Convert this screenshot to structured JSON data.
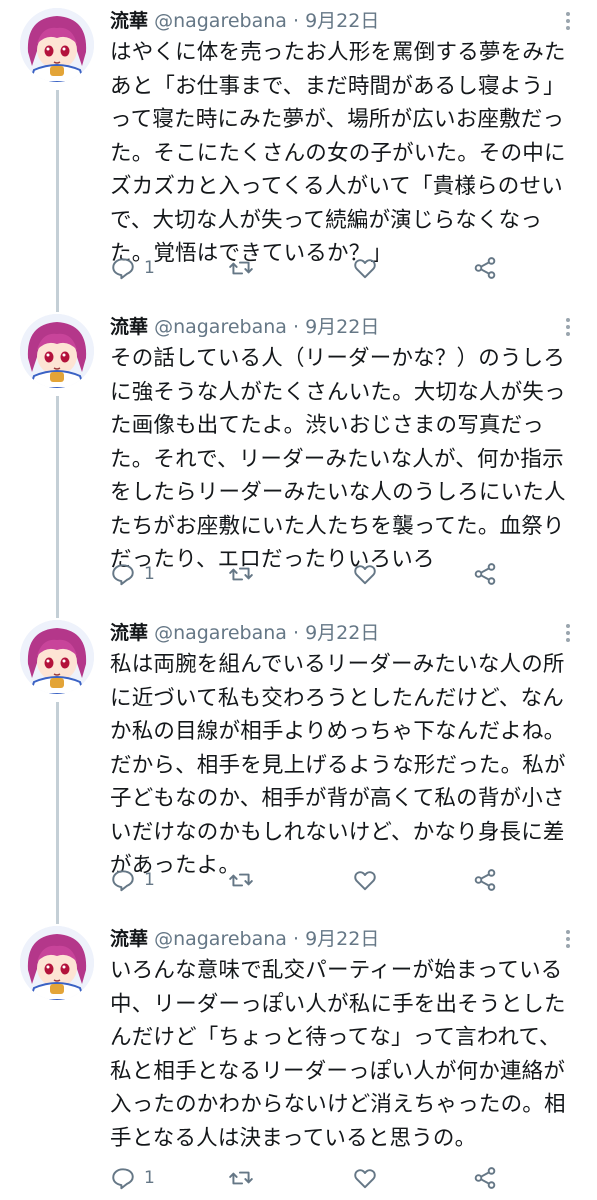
{
  "colors": {
    "text": "#14171a",
    "muted": "#657786",
    "thread_line": "#c4cfd6",
    "icon": "#657786"
  },
  "icons": {
    "reply": "reply-icon",
    "retweet": "retweet-icon",
    "like": "heart-icon",
    "share": "share-icon",
    "more": "more-caret-icon"
  },
  "tweets": [
    {
      "name": "流華",
      "handle": "@nagarebana",
      "separator": "·",
      "date": "9月22日",
      "text": "はやくに体を売ったお人形を罵倒する夢をみたあと「お仕事まで、まだ時間があるし寝よう」って寝た時にみた夢が、場所が広いお座敷だった。そこにたくさんの女の子がいた。その中にズカズカと入ってくる人がいて「貴様らのせいで、大切な人が失って続編が演じらなくなった。覚悟はできているか？」",
      "reply_count": "1"
    },
    {
      "name": "流華",
      "handle": "@nagarebana",
      "separator": "·",
      "date": "9月22日",
      "text": "その話している人（リーダーかな？）のうしろに強そうな人がたくさんいた。大切な人が失った画像も出てたよ。渋いおじさまの写真だった。それで、リーダーみたいな人が、何か指示をしたらリーダーみたいな人のうしろにいた人たちがお座敷にいた人たちを襲ってた。血祭りだったり、エロだったりいろいろ",
      "reply_count": "1"
    },
    {
      "name": "流華",
      "handle": "@nagarebana",
      "separator": "·",
      "date": "9月22日",
      "text": "私は両腕を組んでいるリーダーみたいな人の所に近づいて私も交わろうとしたんだけど、なんか私の目線が相手よりめっちゃ下なんだよね。だから、相手を見上げるような形だった。私が子どもなのか、相手が背が高くて私の背が小さいだけなのかもしれないけど、かなり身長に差があったよ。",
      "reply_count": "1"
    },
    {
      "name": "流華",
      "handle": "@nagarebana",
      "separator": "·",
      "date": "9月22日",
      "text": "いろんな意味で乱交パーティーが始まっている中、リーダーっぽい人が私に手を出そうとしたんだけど「ちょっと待ってな」って言われて、私と相手となるリーダーっぽい人が何か連絡が入ったのかわからないけど消えちゃったの。相手となる人は決まっていると思うの。",
      "reply_count": "1"
    }
  ]
}
